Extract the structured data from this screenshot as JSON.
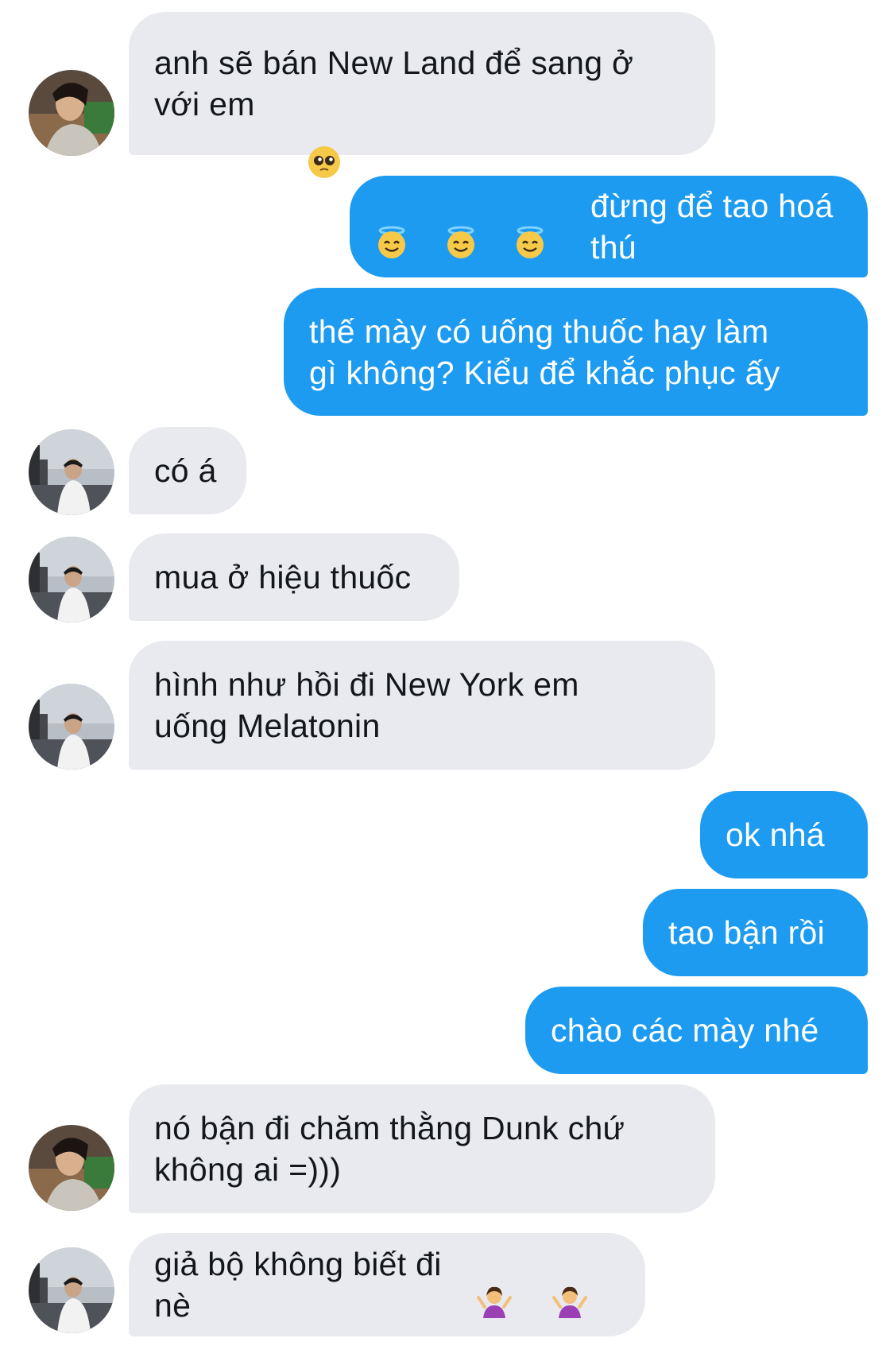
{
  "messages": [
    {
      "side": "in",
      "text": "anh sẽ bán New Land để sang ở\nvới em",
      "emoji": [
        "pleading-face"
      ]
    },
    {
      "side": "out",
      "text": "đừng để tao hoá thú",
      "emoji_before": [
        "smiling-halo-face",
        "smiling-halo-face",
        "smiling-halo-face"
      ]
    },
    {
      "side": "out",
      "text": "thế mày có uống thuốc hay làm\ngì không? Kiểu để khắc phục ấy"
    },
    {
      "side": "in",
      "text": "có á"
    },
    {
      "side": "in",
      "text": "mua ở hiệu thuốc"
    },
    {
      "side": "in",
      "text": "hình như hồi đi New York em\nuống Melatonin"
    },
    {
      "side": "out",
      "text": "ok nhá"
    },
    {
      "side": "out",
      "text": "tao bận rồi"
    },
    {
      "side": "out",
      "text": "chào các mày nhé"
    },
    {
      "side": "in",
      "text": "nó bận đi chăm thằng Dunk chứ\nkhông ai =)))"
    },
    {
      "side": "in",
      "text": "giả bộ không biết đi nè",
      "emoji": [
        "person-shrugging",
        "person-shrugging"
      ]
    }
  ],
  "colors": {
    "incoming_bubble": "#e8eaef",
    "outgoing_bubble": "#1d9bf0",
    "incoming_text": "#14171a",
    "outgoing_text": "#ffffff"
  }
}
